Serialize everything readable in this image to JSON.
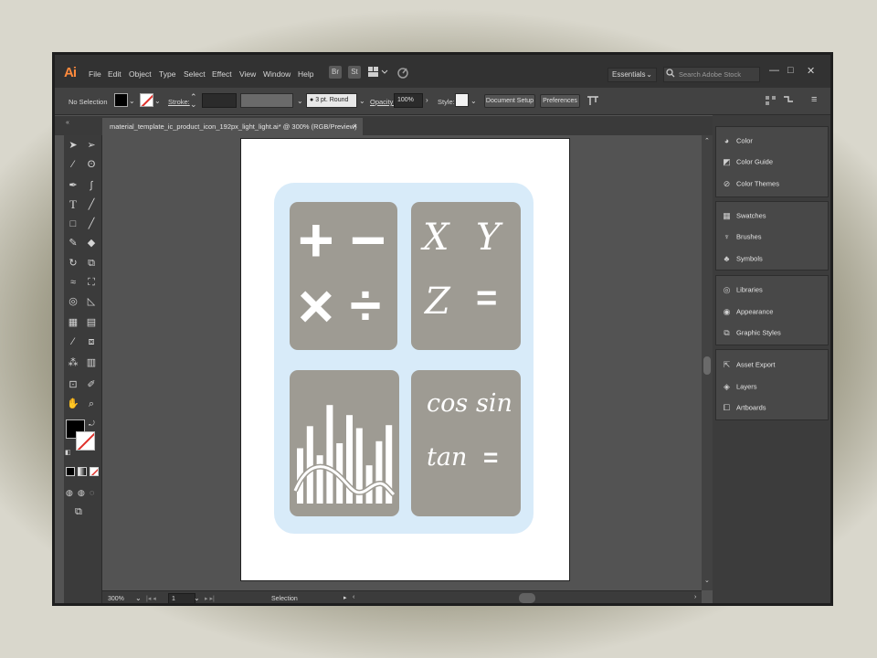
{
  "app": {
    "logo": "Ai"
  },
  "menu": [
    "File",
    "Edit",
    "Object",
    "Type",
    "Select",
    "Effect",
    "View",
    "Window",
    "Help"
  ],
  "toolbar_icons": [
    "Br",
    "St"
  ],
  "workspace": {
    "label": "Essentials"
  },
  "search": {
    "placeholder": "Search Adobe Stock"
  },
  "control": {
    "selection": "No Selection",
    "stroke_label": "Stroke:",
    "brush": "3 pt. Round",
    "opacity_label": "Opacity:",
    "opacity_value": "100%",
    "style_label": "Style:",
    "document_setup": "Document Setup",
    "preferences": "Preferences"
  },
  "document_tab": {
    "title": "material_template_ic_product_icon_192px_light_light.ai* @ 300% (RGB/Preview)",
    "close": "×"
  },
  "artwork": {
    "tile1": {
      "plus": "+",
      "minus": "−",
      "times": "×",
      "divide": "÷"
    },
    "tile2": {
      "x": "X",
      "y": "Y",
      "z": "Z",
      "eq": "="
    },
    "tile4": {
      "cos": "cos",
      "sin": "sin",
      "tan": "tan",
      "eq": "="
    },
    "chart_bars": [
      0.55,
      0.77,
      0.48,
      0.98,
      0.6,
      0.88,
      0.75,
      0.38,
      0.62,
      0.78
    ],
    "colors": {
      "background": "#d8ebf9",
      "tile": "#9e9b93",
      "glyph": "#ffffff"
    }
  },
  "status": {
    "zoom": "300%",
    "artboard": "1",
    "tool": "Selection"
  },
  "panels": [
    {
      "icon": "color-icon",
      "label": "Color"
    },
    {
      "icon": "color-guide-icon",
      "label": "Color Guide"
    },
    {
      "icon": "color-themes-icon",
      "label": "Color Themes"
    },
    {
      "icon": "swatches-icon",
      "label": "Swatches"
    },
    {
      "icon": "brushes-icon",
      "label": "Brushes"
    },
    {
      "icon": "symbols-icon",
      "label": "Symbols"
    },
    {
      "icon": "libraries-icon",
      "label": "Libraries"
    },
    {
      "icon": "appearance-icon",
      "label": "Appearance"
    },
    {
      "icon": "graphic-styles-icon",
      "label": "Graphic Styles"
    },
    {
      "icon": "asset-export-icon",
      "label": "Asset Export"
    },
    {
      "icon": "layers-icon",
      "label": "Layers"
    },
    {
      "icon": "artboards-icon",
      "label": "Artboards"
    }
  ]
}
